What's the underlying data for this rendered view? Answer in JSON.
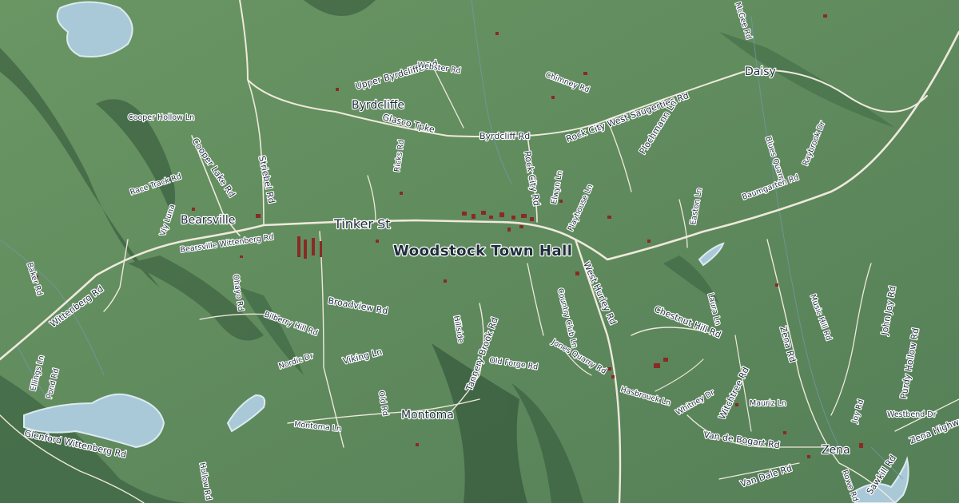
{
  "map": {
    "colors": {
      "land": "#5f8a5c",
      "ridge": "#3d6342",
      "road": "#efe9dc",
      "water": "#a9c9d8",
      "building": "#8a2a25"
    },
    "places": {
      "woodstock_town_hall": "Woodstock Town Hall",
      "bearsville": "Bearsville",
      "byrdcliffe": "Byrdcliffe",
      "daisy": "Daisy",
      "montoma": "Montoma",
      "zena": "Zena"
    },
    "roads": {
      "tinker_st": "Tinker St",
      "west_hurley_rd": "West Hurley Rd",
      "glasco_tpke": "Glasco Tpke",
      "rock_city_west_saugerties_rd": "Rock City West Saugerties Rd",
      "upper_byrdcliffe_rd": "Upper Byrdcliffe Rd",
      "webster_rd": "Webster Rd",
      "byrdcliff_rd": "Byrdcliff Rd",
      "chimney_rd": "Chimney Rd",
      "plochmann_ln": "Plochmann Ln",
      "raybrook_dr": "Raybrook Dr",
      "blues_quarry": "Blues Quarry",
      "mcgee_rd": "McGee Rd",
      "cooper_hollow_ln": "Cooper Hollow Ln",
      "cooper_lake_rd": "Cooper Lake Rd",
      "race_track_rd": "Race Track Rd",
      "striebel_rd": "Striebel Rd",
      "ricks_rd": "Ricks Rd",
      "rock_city_rd": "Rock City Rd",
      "elwyn_ln": "Elwyn Ln",
      "playhouse_ln": "Playhouse Ln",
      "baumgarten_rd": "Baumgarten Rd",
      "easton_ln": "Easton Ln",
      "vly_luna": "Vly Luna",
      "bearsville_wittenberg_rd": "Bearsville Wittenberg Rd",
      "baker_rd": "Baker Rd",
      "wittenberg_rd": "Wittenberg Rd",
      "ohayo_rd": "Ohayo Rd",
      "broadview_rd": "Broadview Rd",
      "bilberry_hill_rd": "Bilberry Hill Rd",
      "viking_ln": "Viking Ln",
      "nordic_dr": "Nordic Dr",
      "ellings_ln": "Ellings Ln",
      "pond_rd": "Pond Rd",
      "glenford_wittenberg_rd": "Glenford Wittenberg Rd",
      "montoma_ln": "Montoma Ln",
      "old_rd": "Old Rd",
      "tannery_brook_rd": "Tannery Brook Rd",
      "hillside": "Hillside",
      "old_forge_rd": "Old Forge Rd",
      "country_club_ln": "Country Club Ln",
      "jones_quarry_rd": "Jones Quarry Rd",
      "chestnut_hill_rd": "Chestnut Hill Rd",
      "hasbrouck_ln": "Hasbrouck Ln",
      "laura_ln": "Laura Ln",
      "zena_rd": "Zena Rd",
      "music_hill_rd": "Music Hill Rd",
      "john_joy_rd": "John Joy Rd",
      "purdy_hollow_rd": "Purdy Hollow Rd",
      "joy_rd": "Joy Rd",
      "westbend_dr": "Westbend Dr",
      "zena_highwoods": "Zena Highwoods",
      "witchtree_rd": "Witchtree Rd",
      "mauriz_ln": "Mauriz Ln",
      "whitney_dr": "Whitney Dr",
      "van_de_bogart_rd": "Van de Bogart Rd",
      "van_dale_rd": "Van Dale Rd",
      "sawkill_rd": "Sawkill Rd",
      "rowe_rd": "Rowe Rd",
      "hollow_rd": "Hollow Rd"
    }
  }
}
